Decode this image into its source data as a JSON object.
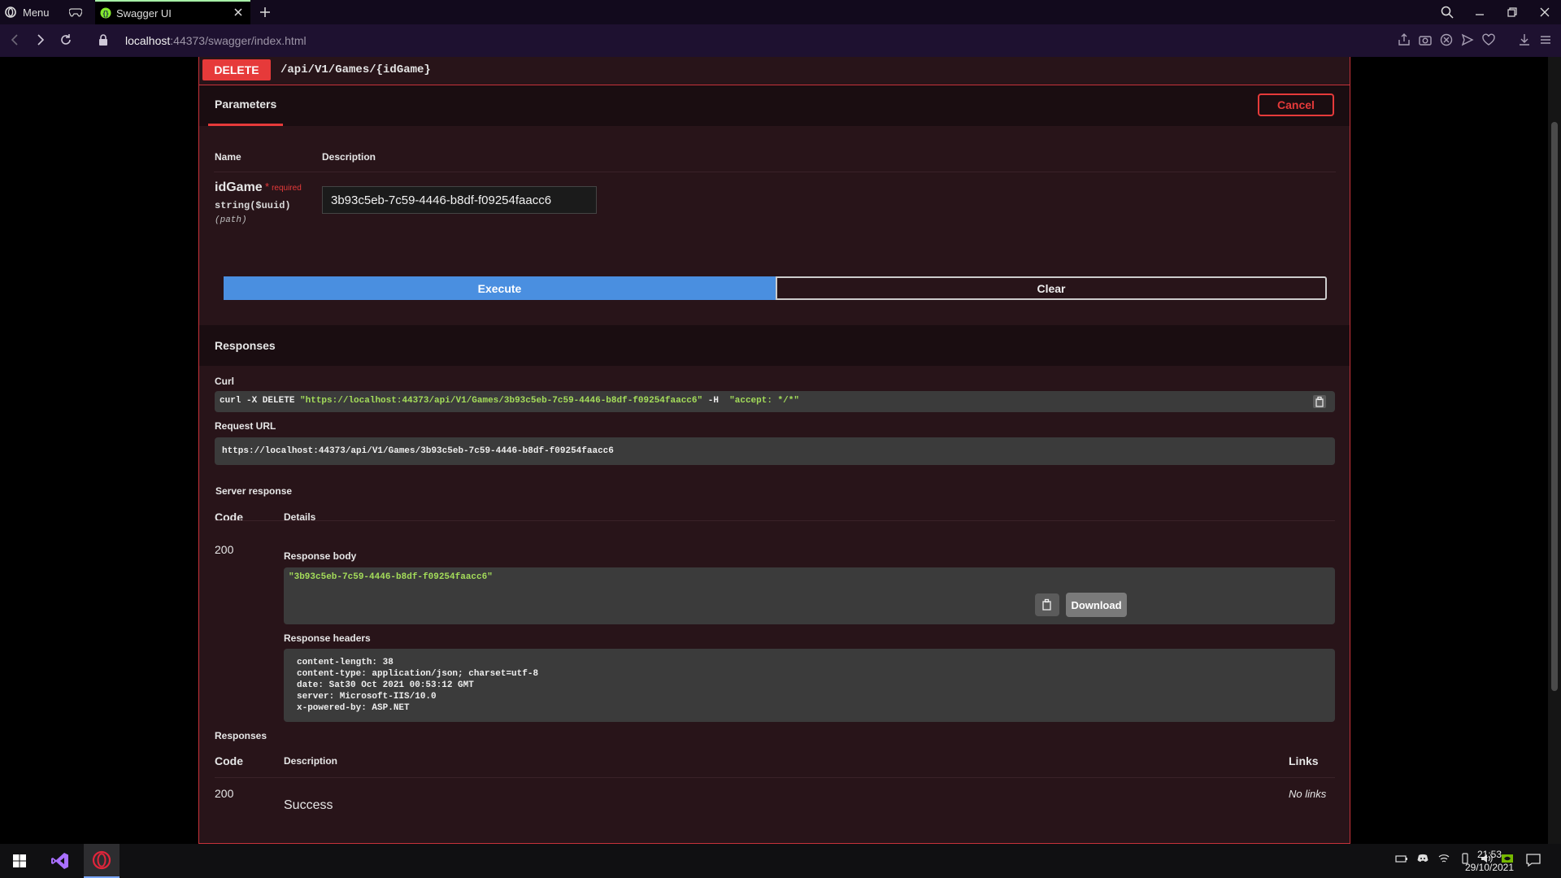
{
  "browser": {
    "menu_label": "Menu",
    "active_tab_title": "Swagger UI",
    "url_host": "localhost",
    "url_rest": ":44373/swagger/index.html"
  },
  "operation": {
    "method": "DELETE",
    "path": "/api/V1/Games/{idGame}",
    "parameters_title": "Parameters",
    "cancel_label": "Cancel",
    "col_name": "Name",
    "col_description": "Description",
    "param": {
      "name": "idGame",
      "required_label": "required",
      "required_star": "*",
      "type": "string($uuid)",
      "in": "(path)",
      "value": "3b93c5eb-7c59-4446-b8df-f09254faacc6"
    },
    "execute_label": "Execute",
    "clear_label": "Clear"
  },
  "responses": {
    "title": "Responses",
    "curl_label": "Curl",
    "curl_prefix": "curl -X DELETE ",
    "curl_url": "\"https://localhost:44373/api/V1/Games/3b93c5eb-7c59-4446-b8df-f09254faacc6\"",
    "curl_mid": " -H  ",
    "curl_header": "\"accept: */*\"",
    "request_url_label": "Request URL",
    "request_url": "https://localhost:44373/api/V1/Games/3b93c5eb-7c59-4446-b8df-f09254faacc6",
    "server_response_label": "Server response",
    "col_code": "Code",
    "col_details": "Details",
    "server_code": "200",
    "response_body_label": "Response body",
    "response_body": "\"3b93c5eb-7c59-4446-b8df-f09254faacc6\"",
    "download_label": "Download",
    "response_headers_label": "Response headers",
    "headers": [
      "content-length: 38",
      "content-type: application/json; charset=utf-8",
      "date: Sat30 Oct 2021 00:53:12 GMT",
      "server: Microsoft-IIS/10.0",
      "x-powered-by: ASP.NET"
    ],
    "doc_responses_label": "Responses",
    "doc_col_code": "Code",
    "doc_col_description": "Description",
    "doc_col_links": "Links",
    "doc_code": "200",
    "doc_description": "Success",
    "doc_links": "No links"
  },
  "taskbar": {
    "time": "21:53",
    "date": "29/10/2021"
  },
  "colors": {
    "delete_red": "#e63a3a",
    "execute_blue": "#4a8fe0",
    "json_green": "#a4dd5a",
    "panel_bg": "#281419"
  },
  "icons": [
    "opera-icon",
    "gamepad-icon",
    "swagger-favicon",
    "close-icon",
    "plus-icon",
    "search-icon",
    "minimize-icon",
    "restore-icon",
    "window-close-icon",
    "back-icon",
    "forward-icon",
    "reload-icon",
    "lock-icon",
    "share-icon",
    "camera-icon",
    "shield-icon",
    "send-icon",
    "heart-icon",
    "download-icon",
    "menu-icon",
    "copy-icon",
    "windows-start-icon",
    "visual-studio-icon",
    "notification-icon"
  ]
}
